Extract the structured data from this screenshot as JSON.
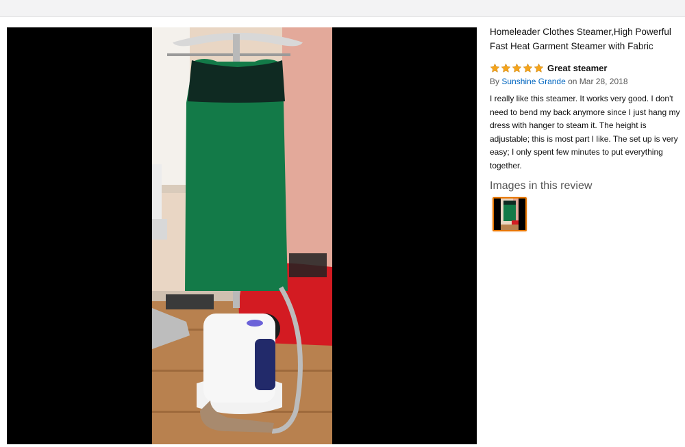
{
  "product": {
    "title": "Homeleader Clothes Steamer,High Powerful Fast Heat Garment Steamer with Fabric"
  },
  "review": {
    "stars": 5,
    "rating_max": 5,
    "star_icon": "star-icon",
    "title": "Great steamer",
    "by_prefix": "By",
    "author": "Sunshine Grande",
    "date_text": "on Mar 28, 2018",
    "body": "I really like this steamer. It works very good. I don't need to bend my back anymore since I just hang my dress with hanger to steam it. The height is adjustable; this is most part I like. The set up is very easy; I only spent few minutes to put everything together."
  },
  "images_section": {
    "heading": "Images in this review",
    "thumbnail_count": 1
  },
  "colors": {
    "star": "#f4a41c",
    "link": "#0066c0",
    "thumb_border": "#e77600",
    "viewer_bg": "#000000"
  }
}
